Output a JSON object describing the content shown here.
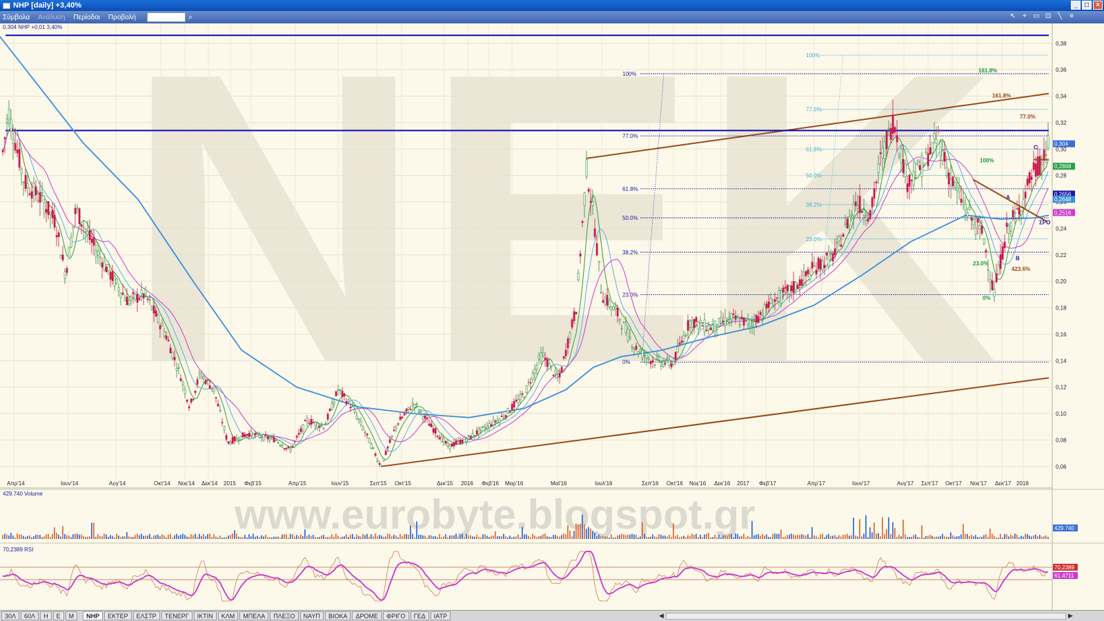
{
  "window": {
    "title": "NHP [daily] +3,40%"
  },
  "menu": {
    "items": [
      "Σύμβολα",
      "Ανάλυση",
      "Περίοδοι",
      "Προβολή"
    ]
  },
  "bottom_tabs": [
    "30Λ",
    "60Λ",
    "Η",
    "Ε",
    "Μ",
    "NHP",
    "ΕΚΤΕΡ",
    "ΕΛΣΤΡ",
    "ΤΕΝΕΡΓ",
    "ΙΚΤΙΝ",
    "ΚΛΜ",
    "ΜΠΕΛΑ",
    "ΠΛΕΞΟ",
    "ΝΑΥΠ",
    "ΒΙΟΚΑ",
    "ΔΡΟΜΕ",
    "ΦΡΙΓΟ",
    "ΓΕΔ",
    "ΙΑΤΡ"
  ],
  "active_tab": "NHP",
  "colors": {
    "up": "#2f8a3a",
    "down": "#c8174c",
    "ma_long": "#3a8fdc",
    "ma_mid": "#5ab0e8",
    "ma_fast": "#cc3ccc",
    "hline": "#0a0ab4",
    "channel": "#9a4a1a",
    "fib": "#1a1aa8",
    "rsi": "#cc33cc",
    "bg": "#fcf8ea"
  },
  "chart_data": {
    "type": "line",
    "subtype": "candlestick",
    "title": "0,304 NHP +0,01 3,40%",
    "xlabel": "",
    "ylabel": "",
    "x_ticks": [
      "Απρ'14",
      "Ιουν'14",
      "Αυγ'14",
      "Οκτ'14",
      "Νοε'14",
      "Δεκ'14",
      "2015",
      "Φεβ'15",
      "Απρ'15",
      "Ιουν'15",
      "Σεπ'15",
      "Οκτ'15",
      "Δεκ'15",
      "2016",
      "Φεβ'16",
      "Μαρ'16",
      "Μαϊ'16",
      "Ιουλ'16",
      "Σεπ'16",
      "Οκτ'16",
      "Νοε'16",
      "Δεκ'16",
      "2017",
      "Φεβ'17",
      "Απρ'17",
      "Ιουν'17",
      "Αυγ'17",
      "Σεπ'17",
      "Οκτ'17",
      "Νοε'17",
      "Δεκ'17",
      "2018"
    ],
    "y_ticks": [
      "0,06",
      "0,08",
      "0,10",
      "0,12",
      "0,14",
      "0,16",
      "0,18",
      "0,20",
      "0,22",
      "0,24",
      "0,26",
      "0,28",
      "0,30",
      "0,32",
      "0,34",
      "0,36",
      "0,38"
    ],
    "ylim": [
      0.05,
      0.395
    ],
    "price_path": [
      [
        0,
        0.29
      ],
      [
        5,
        0.3
      ],
      [
        12,
        0.33
      ],
      [
        20,
        0.31
      ],
      [
        35,
        0.275
      ],
      [
        60,
        0.262
      ],
      [
        80,
        0.245
      ],
      [
        95,
        0.205
      ],
      [
        110,
        0.255
      ],
      [
        130,
        0.232
      ],
      [
        160,
        0.205
      ],
      [
        185,
        0.185
      ],
      [
        210,
        0.19
      ],
      [
        240,
        0.16
      ],
      [
        262,
        0.128
      ],
      [
        275,
        0.105
      ],
      [
        290,
        0.13
      ],
      [
        310,
        0.118
      ],
      [
        330,
        0.078
      ],
      [
        360,
        0.085
      ],
      [
        400,
        0.08
      ],
      [
        420,
        0.072
      ],
      [
        445,
        0.095
      ],
      [
        470,
        0.09
      ],
      [
        490,
        0.118
      ],
      [
        510,
        0.105
      ],
      [
        530,
        0.085
      ],
      [
        552,
        0.06
      ],
      [
        575,
        0.092
      ],
      [
        600,
        0.108
      ],
      [
        625,
        0.09
      ],
      [
        650,
        0.075
      ],
      [
        680,
        0.082
      ],
      [
        705,
        0.09
      ],
      [
        730,
        0.098
      ],
      [
        760,
        0.115
      ],
      [
        785,
        0.145
      ],
      [
        810,
        0.125
      ],
      [
        835,
        0.18
      ],
      [
        850,
        0.285
      ],
      [
        860,
        0.25
      ],
      [
        872,
        0.19
      ],
      [
        895,
        0.175
      ],
      [
        920,
        0.15
      ],
      [
        945,
        0.14
      ],
      [
        975,
        0.138
      ],
      [
        1000,
        0.17
      ],
      [
        1030,
        0.165
      ],
      [
        1060,
        0.172
      ],
      [
        1090,
        0.168
      ],
      [
        1120,
        0.185
      ],
      [
        1150,
        0.195
      ],
      [
        1180,
        0.21
      ],
      [
        1210,
        0.22
      ],
      [
        1240,
        0.26
      ],
      [
        1262,
        0.25
      ],
      [
        1275,
        0.29
      ],
      [
        1295,
        0.322
      ],
      [
        1315,
        0.275
      ],
      [
        1340,
        0.29
      ],
      [
        1360,
        0.31
      ],
      [
        1375,
        0.28
      ],
      [
        1395,
        0.26
      ],
      [
        1410,
        0.245
      ],
      [
        1425,
        0.235
      ],
      [
        1440,
        0.19
      ],
      [
        1460,
        0.24
      ],
      [
        1478,
        0.255
      ],
      [
        1495,
        0.28
      ],
      [
        1510,
        0.29
      ],
      [
        1520,
        0.304
      ]
    ],
    "ma_200": [
      [
        0,
        0.385
      ],
      [
        60,
        0.345
      ],
      [
        120,
        0.305
      ],
      [
        200,
        0.262
      ],
      [
        280,
        0.2
      ],
      [
        350,
        0.148
      ],
      [
        430,
        0.12
      ],
      [
        520,
        0.105
      ],
      [
        600,
        0.1
      ],
      [
        680,
        0.097
      ],
      [
        760,
        0.104
      ],
      [
        820,
        0.118
      ],
      [
        860,
        0.135
      ],
      [
        900,
        0.143
      ],
      [
        960,
        0.148
      ],
      [
        1030,
        0.158
      ],
      [
        1100,
        0.166
      ],
      [
        1180,
        0.182
      ],
      [
        1250,
        0.205
      ],
      [
        1320,
        0.23
      ],
      [
        1400,
        0.25
      ],
      [
        1450,
        0.247
      ],
      [
        1500,
        0.248
      ],
      [
        1520,
        0.25
      ]
    ],
    "horizontal_lines": [
      0.386,
      0.314
    ],
    "channel_top": [
      [
        850,
        0.293
      ],
      [
        1520,
        0.342
      ]
    ],
    "channel_bottom": [
      [
        552,
        0.06
      ],
      [
        1520,
        0.127
      ]
    ],
    "fib_levels": [
      {
        "label": "100%",
        "value": 0.357
      },
      {
        "label": "77.0%",
        "value": 0.31
      },
      {
        "label": "61.8%",
        "value": 0.27
      },
      {
        "label": "50.0%",
        "value": 0.248
      },
      {
        "label": "38.2%",
        "value": 0.222
      },
      {
        "label": "23.0%",
        "value": 0.19
      },
      {
        "label": "0%",
        "value": 0.139
      }
    ],
    "fib_levels_2": [
      {
        "label": "100%",
        "value": 0.371
      },
      {
        "label": "77.0%",
        "value": 0.33
      },
      {
        "label": "61.8%",
        "value": 0.3
      },
      {
        "label": "50.0%",
        "value": 0.28
      },
      {
        "label": "38.2%",
        "value": 0.258
      },
      {
        "label": "23.0%",
        "value": 0.232
      }
    ],
    "right_labels": [
      {
        "label": "0,304",
        "value": 0.304,
        "bg": "#3a6fd8"
      },
      {
        "label": "0,2868",
        "value": 0.287,
        "bg": "#28a048"
      },
      {
        "label": "0,2656",
        "value": 0.266,
        "bg": "#1a1aa8"
      },
      {
        "label": "0,2648",
        "value": 0.262,
        "bg": "#3a8fdc"
      },
      {
        "label": "0,2516",
        "value": 0.252,
        "bg": "#cc3ccc"
      }
    ],
    "annotations": [
      {
        "text": "161.8%",
        "x": 1418,
        "value": 0.358,
        "color": "#1a9a3a"
      },
      {
        "text": "161.8%",
        "x": 1438,
        "value": 0.339,
        "color": "#9a4a1a"
      },
      {
        "text": "77.0%",
        "x": 1478,
        "value": 0.323,
        "color": "#9a4a1a"
      },
      {
        "text": "100%",
        "x": 1420,
        "value": 0.29,
        "color": "#1a9a3a"
      },
      {
        "text": "A",
        "x": 1458,
        "value": 0.262,
        "color": "#1a1aa8"
      },
      {
        "text": "B",
        "x": 1472,
        "value": 0.216,
        "color": "#1a1aa8"
      },
      {
        "text": "C",
        "x": 1498,
        "value": 0.3,
        "color": "#1a1aa8"
      },
      {
        "text": "23.0%",
        "x": 1410,
        "value": 0.212,
        "color": "#1a9a3a"
      },
      {
        "text": "423.6%",
        "x": 1466,
        "value": 0.208,
        "color": "#9a4a1a"
      },
      {
        "text": "0%",
        "x": 1424,
        "value": 0.186,
        "color": "#1a9a3a"
      },
      {
        "text": "ΣΡΟ",
        "x": 1506,
        "value": 0.243,
        "color": "#1a1aa8"
      }
    ],
    "volume": {
      "label": "429.740 Volume",
      "value_label": "429.740"
    },
    "rsi": {
      "label": "70,2389 RSI",
      "value_labels": [
        "70,2389",
        "61,4711"
      ]
    }
  }
}
